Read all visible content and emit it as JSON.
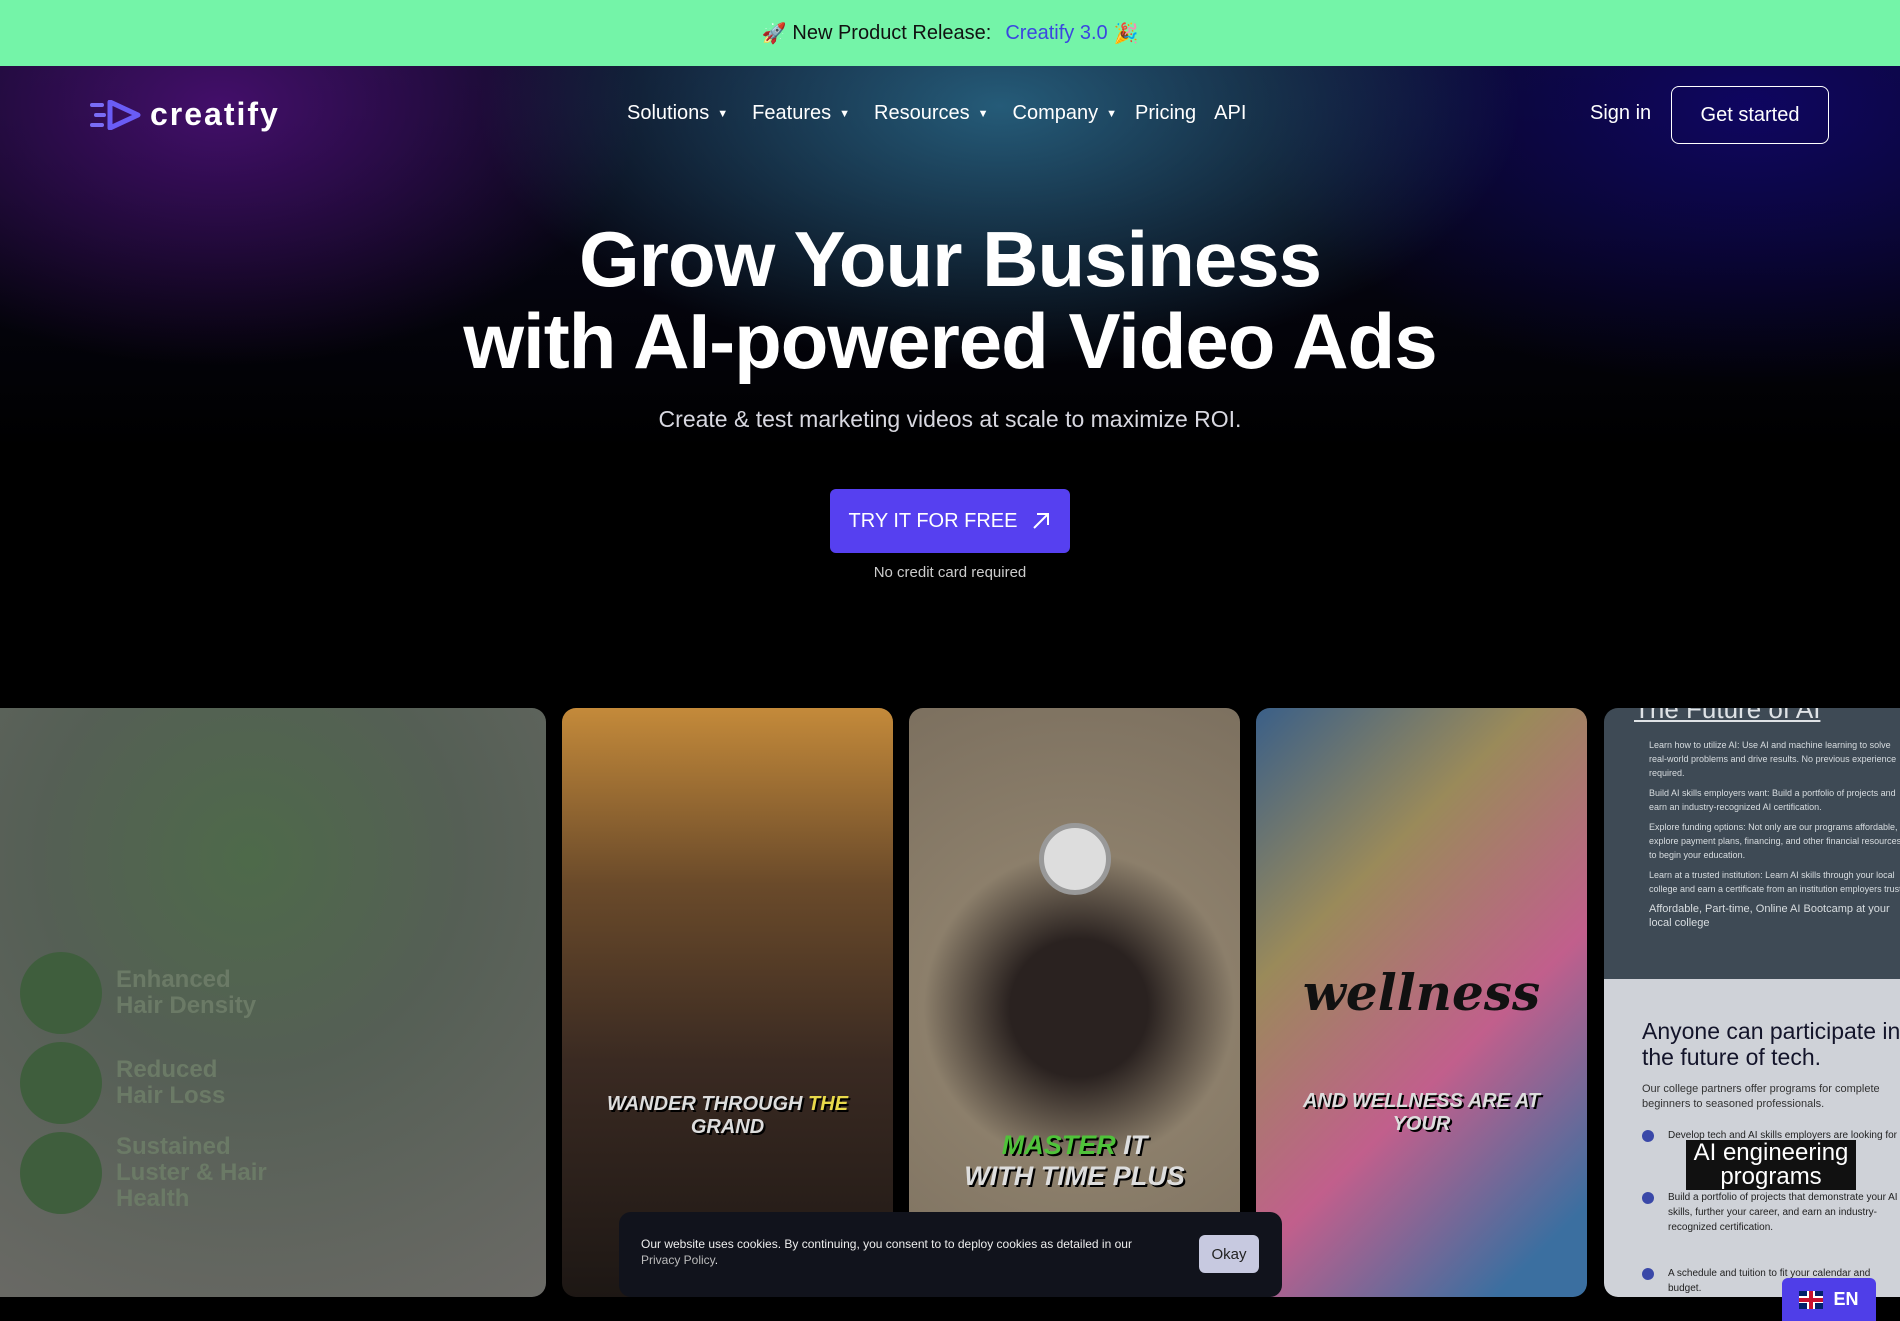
{
  "banner": {
    "icon_left": "rocket-icon",
    "text": "New Product Release:",
    "link": "Creatify 3.0",
    "icon_right": "party-popper-icon"
  },
  "nav": {
    "logo": "creatify",
    "items": [
      {
        "label": "Solutions",
        "dropdown": true
      },
      {
        "label": "Features",
        "dropdown": true
      },
      {
        "label": "Resources",
        "dropdown": true
      },
      {
        "label": "Company",
        "dropdown": true
      },
      {
        "label": "Pricing",
        "dropdown": false
      },
      {
        "label": "API",
        "dropdown": false
      }
    ],
    "sign_in": "Sign in",
    "get_started": "Get started"
  },
  "hero": {
    "title_line1": "Grow Your Business",
    "title_line2": "with AI-powered Video Ads",
    "subtitle": "Create & test marketing videos at scale to maximize ROI.",
    "cta": "TRY IT FOR FREE",
    "cta_icon": "arrow-up-right-icon",
    "note": "No credit card required"
  },
  "cards": {
    "c1": {
      "features": [
        "Enhanced Hair Density",
        "Reduced Hair Loss",
        "Sustained Luster & Hair Health"
      ]
    },
    "c2": {
      "caption_a": "WANDER THROUGH",
      "caption_b": "THE",
      "caption_c": "GRAND"
    },
    "c3": {
      "caption_a": "MASTER",
      "caption_b": "IT",
      "caption_c": "WITH TIME PLUS"
    },
    "c4": {
      "title": "wellness",
      "caption": "AND WELLNESS ARE AT YOUR"
    },
    "c5": {
      "header": "The Future of AI",
      "bullets": [
        "Learn how to utilize AI: Use AI and machine learning to solve real-world problems and drive results. No previous experience required.",
        "Build AI skills employers want: Build a portfolio of projects and earn an industry-recognized AI certification.",
        "Explore funding options: Not only are our programs affordable, explore payment plans, financing, and other financial resources to begin your education.",
        "Learn at a trusted institution: Learn AI skills through your local college and earn a certificate from an institution employers trust."
      ],
      "tagline": "Affordable, Part-time, Online AI Bootcamp at your local college",
      "heading": "Anyone can participate in the future of tech.",
      "para": "Our college partners offer programs for complete beginners to seasoned professionals.",
      "list": [
        "Develop tech and AI skills employers are looking for",
        "Build a portfolio of projects that demonstrate your AI skills, further your career, and earn an industry-recognized certification.",
        "A schedule and tuition to fit your calendar and budget."
      ],
      "overlay": "AI engineering programs"
    }
  },
  "cookie": {
    "text": "Our website uses cookies. By continuing, you consent to to deploy cookies as detailed in our",
    "link": "Privacy Policy",
    "end": ".",
    "button": "Okay"
  },
  "language": {
    "code": "EN",
    "flag": "uk-flag-icon"
  },
  "colors": {
    "banner": "#74f4a8",
    "accent": "#5640f0",
    "link": "#3b46e0"
  }
}
